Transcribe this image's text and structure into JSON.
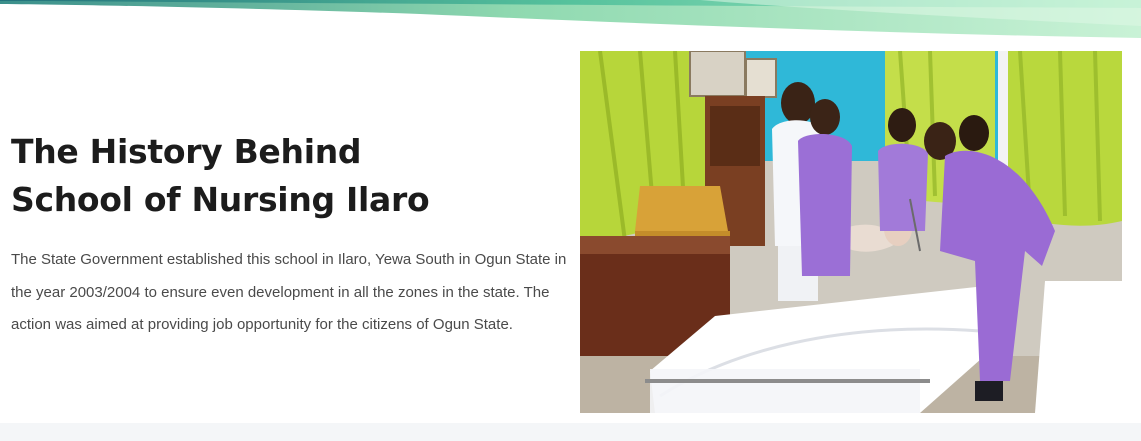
{
  "section": {
    "heading_line1": "The History Behind",
    "heading_line2": "School of Nursing Ilaro",
    "description": "The State Government established this school in Ilaro, Yewa South in Ogun State in the year 2003/2004 to ensure even development in all the zones in the state. The action was aimed at providing job opportunity for the citizens of Ogun State."
  },
  "colors": {
    "heading": "#1c1c1c",
    "body_text": "#4a4a4a",
    "wave_green": "#7fe0a8",
    "wave_teal": "#2e9e8c",
    "scrub_purple": "#9b6fd6",
    "curtain_green": "#b7d63a",
    "wall_blue": "#2fb8d8"
  }
}
